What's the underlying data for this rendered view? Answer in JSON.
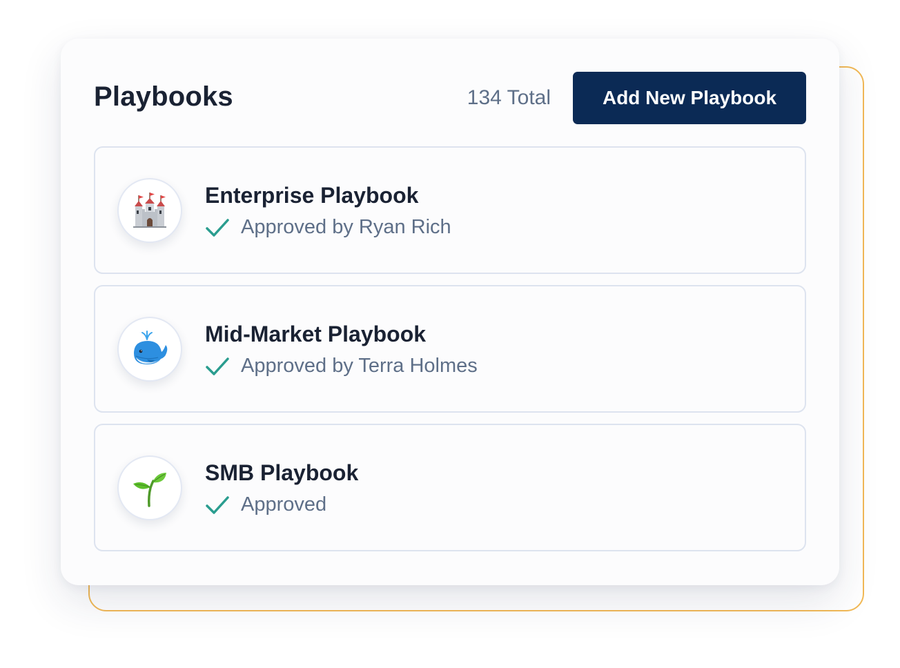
{
  "header": {
    "title": "Playbooks",
    "total": "134 Total",
    "add_button_label": "Add New Playbook"
  },
  "colors": {
    "button": "#0b2a55",
    "accent_frame": "#f2b955",
    "check": "#2a9d8f"
  },
  "playbooks": [
    {
      "name": "Enterprise Playbook",
      "status": "Approved by Ryan Rich",
      "icon": "castle-icon"
    },
    {
      "name": "Mid-Market Playbook",
      "status": "Approved by Terra Holmes",
      "icon": "whale-icon"
    },
    {
      "name": "SMB Playbook",
      "status": "Approved",
      "icon": "seedling-icon"
    }
  ]
}
